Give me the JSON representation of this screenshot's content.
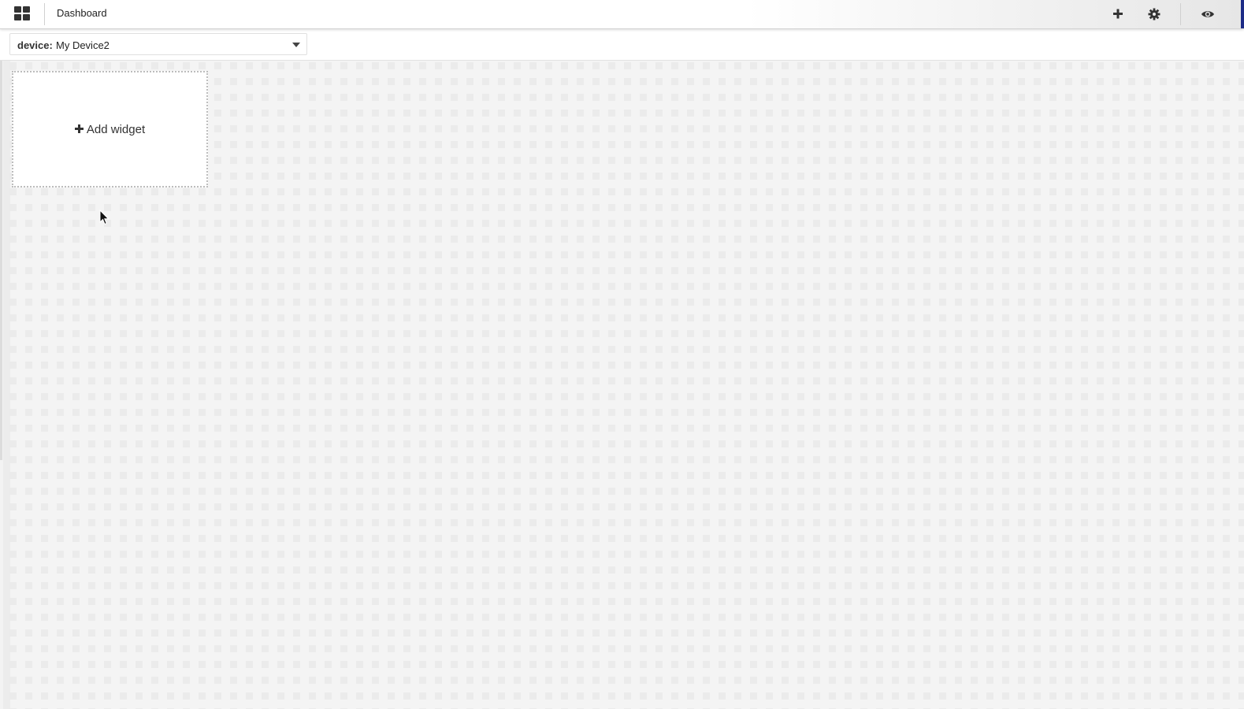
{
  "topbar": {
    "app_icon": "dashboard-grid-icon",
    "title": "Dashboard",
    "actions": [
      {
        "name": "add-icon"
      },
      {
        "name": "gear-icon"
      },
      {
        "name": "eye-icon"
      }
    ],
    "accent_color": "#1c2b86"
  },
  "toolbar": {
    "device_label": "device:",
    "device_value": "My Device2"
  },
  "canvas": {
    "add_widget_label": "Add widget"
  }
}
